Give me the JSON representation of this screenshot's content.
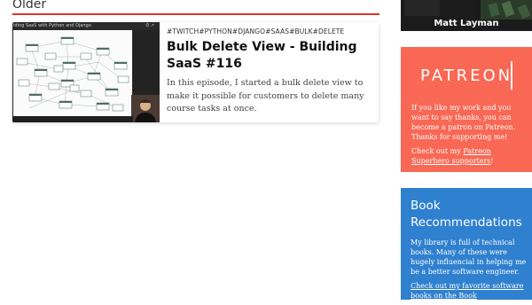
{
  "section": {
    "heading": "Older"
  },
  "post": {
    "tags": "#TWITCH#PYTHON#DJANGO#SAAS#BULK#DELETE",
    "title": "Bulk Delete View - Building SaaS #116",
    "excerpt": "In this episode, I started a bulk delete view to make it possible for customers to delete many course tasks at once.",
    "thumbnail": {
      "caption": "lding SaaS with Python and Django",
      "icons": "⏱ ↗"
    }
  },
  "sidebar": {
    "video": {
      "name": "Matt Layman"
    },
    "patreon": {
      "logo": "PATREON",
      "text": "If you like my work and you want to say thanks, you can become a patron on Patreon. Thanks for supporting me!",
      "cta_prefix": "Check out my ",
      "cta_link": "Patreon Superhero supporters",
      "cta_suffix": "!",
      "color": "#f96854"
    },
    "books": {
      "title": "Book Recommendations",
      "text": "My library is full of technical books. Many of these were hugely influencial in helping me be a better software engineer.",
      "cta_prefix": "Check out my favorite software books on the Book",
      "color": "#2f80cf"
    }
  },
  "colors": {
    "accent": "#e0342c"
  }
}
